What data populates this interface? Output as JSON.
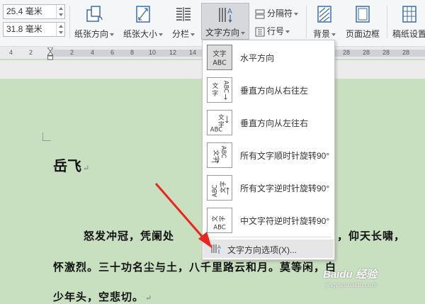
{
  "toolbar": {
    "width_value": "25.4 毫米",
    "height_value": "31.8 毫米",
    "orientation_label": "纸张方向",
    "size_label": "纸张大小",
    "columns_label": "分栏",
    "text_direction_label": "文字方向",
    "separator_label": "分隔符",
    "line_number_label": "行号",
    "background_label": "背景",
    "page_border_label": "页面边框",
    "grid_paper_label": "稿纸设置"
  },
  "ruler": {
    "ticks": [
      "4",
      "2",
      "2",
      "4",
      "6",
      "8",
      "10",
      "12",
      "14",
      "16",
      "18",
      "20",
      "22",
      "24",
      "26",
      "28"
    ]
  },
  "menu": {
    "items": [
      {
        "icon": "text-horizontal-icon",
        "label": "水平方向"
      },
      {
        "icon": "text-vertical-rtl-icon",
        "label": "垂直方向从右往左"
      },
      {
        "icon": "text-vertical-ltr-icon",
        "label": "垂直方向从左往右"
      },
      {
        "icon": "text-rotate-cw-icon",
        "label": "所有文字顺时针旋转90°"
      },
      {
        "icon": "text-rotate-ccw-icon",
        "label": "所有文字逆时针旋转90°"
      },
      {
        "icon": "cjk-rotate-ccw-icon",
        "label": "中文字符逆时针旋转90°"
      }
    ],
    "options_label": "文字方向选项(X)..."
  },
  "document": {
    "title": "岳飞",
    "lines": [
      "怒发冲冠，凭阑处",
      "，仰天长啸，",
      "怀激烈。三十功名尘与土，八千里路云和月。莫等闲，白",
      "少年头，空悲切。"
    ]
  },
  "watermark": {
    "brand": "Baidu 经验",
    "url": "jingyan.baidu.com"
  },
  "colors": {
    "document_bg": "#c8e0c0",
    "arrow": "#e8261f",
    "menu_selected": "#dcdcdc"
  }
}
